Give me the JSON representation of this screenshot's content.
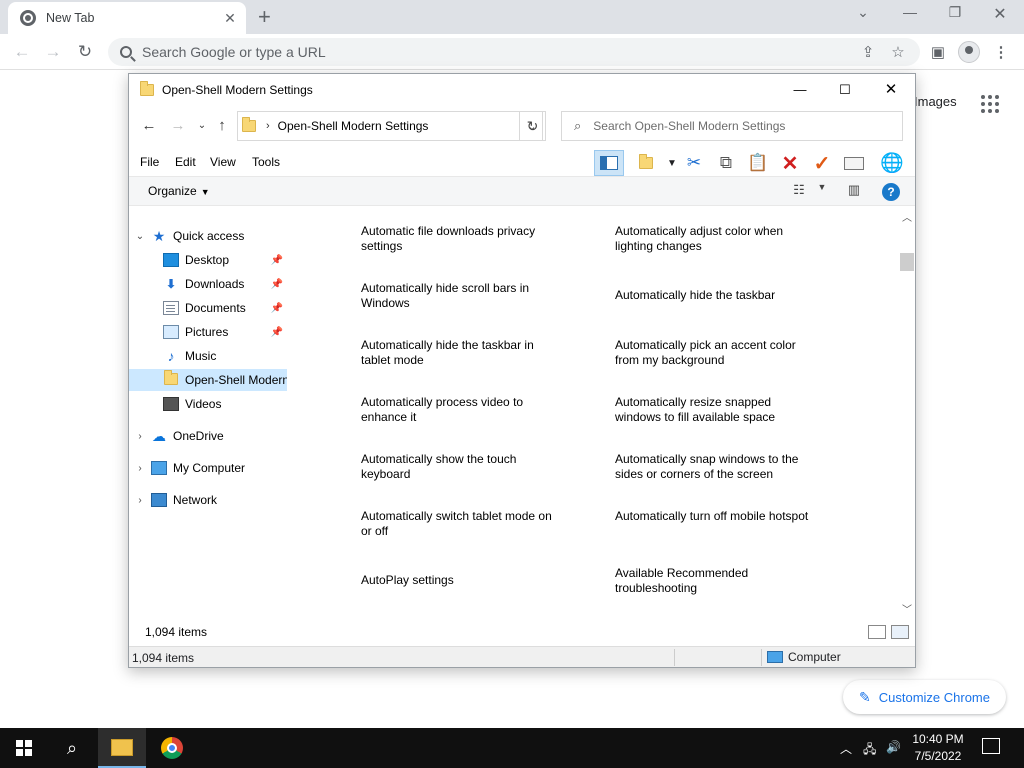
{
  "chrome": {
    "tab_title": "New Tab",
    "tab_close": "✕",
    "new_tab": "+",
    "omnibox_placeholder": "Search Google or type a URL",
    "images_link": "Images",
    "customize_label": "Customize Chrome"
  },
  "explorer": {
    "title": "Open-Shell Modern Settings",
    "address": "Open-Shell Modern Settings",
    "search_placeholder": "Search Open-Shell Modern Settings",
    "menu": [
      "File",
      "Edit",
      "View",
      "Tools"
    ],
    "organize": "Organize",
    "nav": [
      {
        "label": "Quick access",
        "icon": "star-icon",
        "expanded": true
      },
      {
        "label": "Desktop",
        "icon": "desktop-icon",
        "pinned": true
      },
      {
        "label": "Downloads",
        "icon": "downloads-icon",
        "pinned": true
      },
      {
        "label": "Documents",
        "icon": "documents-icon",
        "pinned": true
      },
      {
        "label": "Pictures",
        "icon": "pictures-icon",
        "pinned": true
      },
      {
        "label": "Music",
        "icon": "music-icon"
      },
      {
        "label": "Open-Shell Modern",
        "icon": "folder-icon",
        "selected": true
      },
      {
        "label": "Videos",
        "icon": "videos-icon"
      },
      {
        "label": "OneDrive",
        "icon": "onedrive-icon"
      },
      {
        "label": "My Computer",
        "icon": "computer-icon"
      },
      {
        "label": "Network",
        "icon": "network-icon"
      }
    ],
    "items": [
      "Automatic file downloads privacy settings",
      "Automatically adjust color when lighting changes",
      "Automatically hide scroll bars in Windows",
      "Automatically hide the taskbar",
      "Automatically hide the taskbar in tablet mode",
      "Automatically pick an accent color from my background",
      "Automatically process video to enhance it",
      "Automatically resize snapped windows to fill available space",
      "Automatically show the touch keyboard",
      "Automatically snap windows to the sides or corners of the screen",
      "Automatically switch tablet mode on or off",
      "Automatically turn off mobile hotspot",
      "AutoPlay settings",
      "Available Recommended troubleshooting"
    ],
    "item_count": "1,094 items",
    "status_count": "1,094 items",
    "status_location": "Computer"
  },
  "taskbar": {
    "time": "10:40 PM",
    "date": "7/5/2022"
  },
  "colors": {
    "accent_blue": "#1a73e8",
    "selection": "#cce8ff",
    "taskbar": "#101010"
  }
}
